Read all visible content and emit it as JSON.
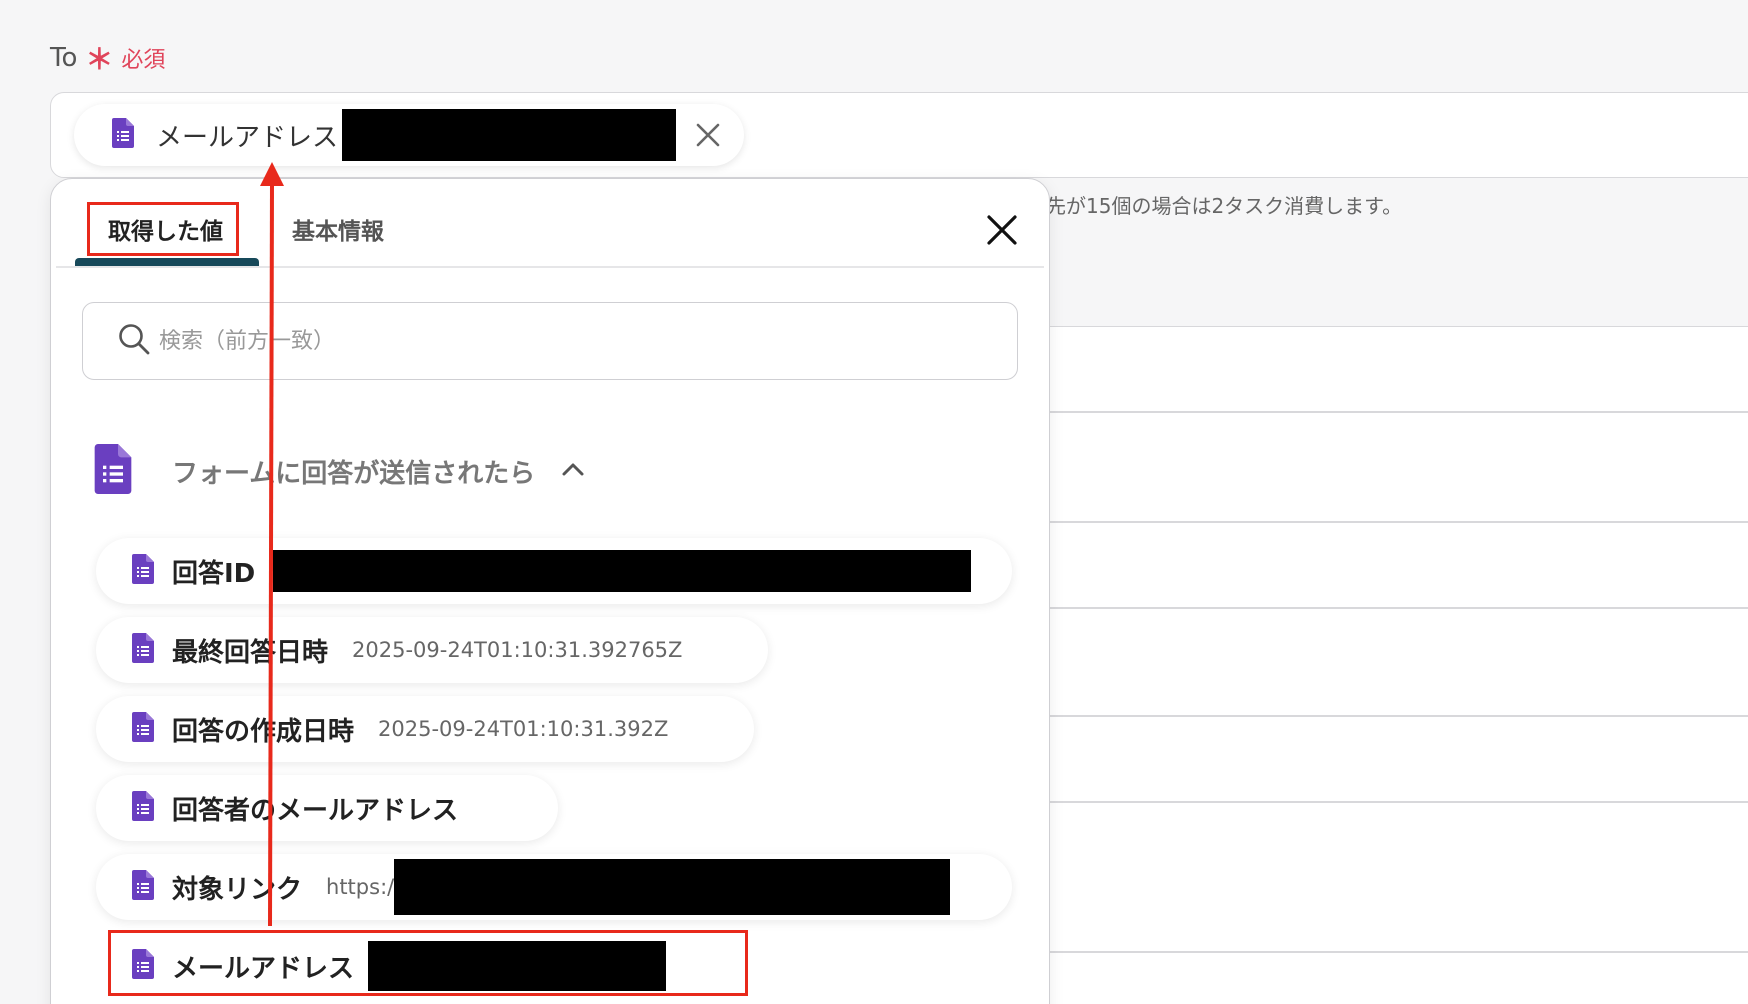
{
  "field": {
    "label": "To",
    "required_mark": "＊",
    "required_text": "必須"
  },
  "to_input": {
    "chip_label": "メールアドレス"
  },
  "hint_text": "先が15個の場合は2タスク消費します。",
  "popup": {
    "tabs": [
      {
        "label": "取得した値",
        "active": true
      },
      {
        "label": "基本情報",
        "active": false
      }
    ],
    "search": {
      "placeholder": "検索（前方一致）"
    },
    "section": {
      "title": "フォームに回答が送信されたら"
    },
    "items": [
      {
        "label": "回答ID",
        "value": ""
      },
      {
        "label": "最終回答日時",
        "value": "2025-09-24T01:10:31.392765Z"
      },
      {
        "label": "回答の作成日時",
        "value": "2025-09-24T01:10:31.392Z"
      },
      {
        "label": "回答者のメールアドレス",
        "value": ""
      },
      {
        "label": "対象リンク",
        "value": "https:/"
      },
      {
        "label": "メールアドレス",
        "value": ""
      }
    ]
  },
  "colors": {
    "accent_red": "#e8291b",
    "forms_purple": "#6a3fc0",
    "tab_underline": "#17495a",
    "required_red": "#e0445a"
  },
  "icons": {
    "doc": "google-forms-icon",
    "close": "close-icon",
    "search": "search-icon",
    "chevron": "chevron-up-icon"
  }
}
